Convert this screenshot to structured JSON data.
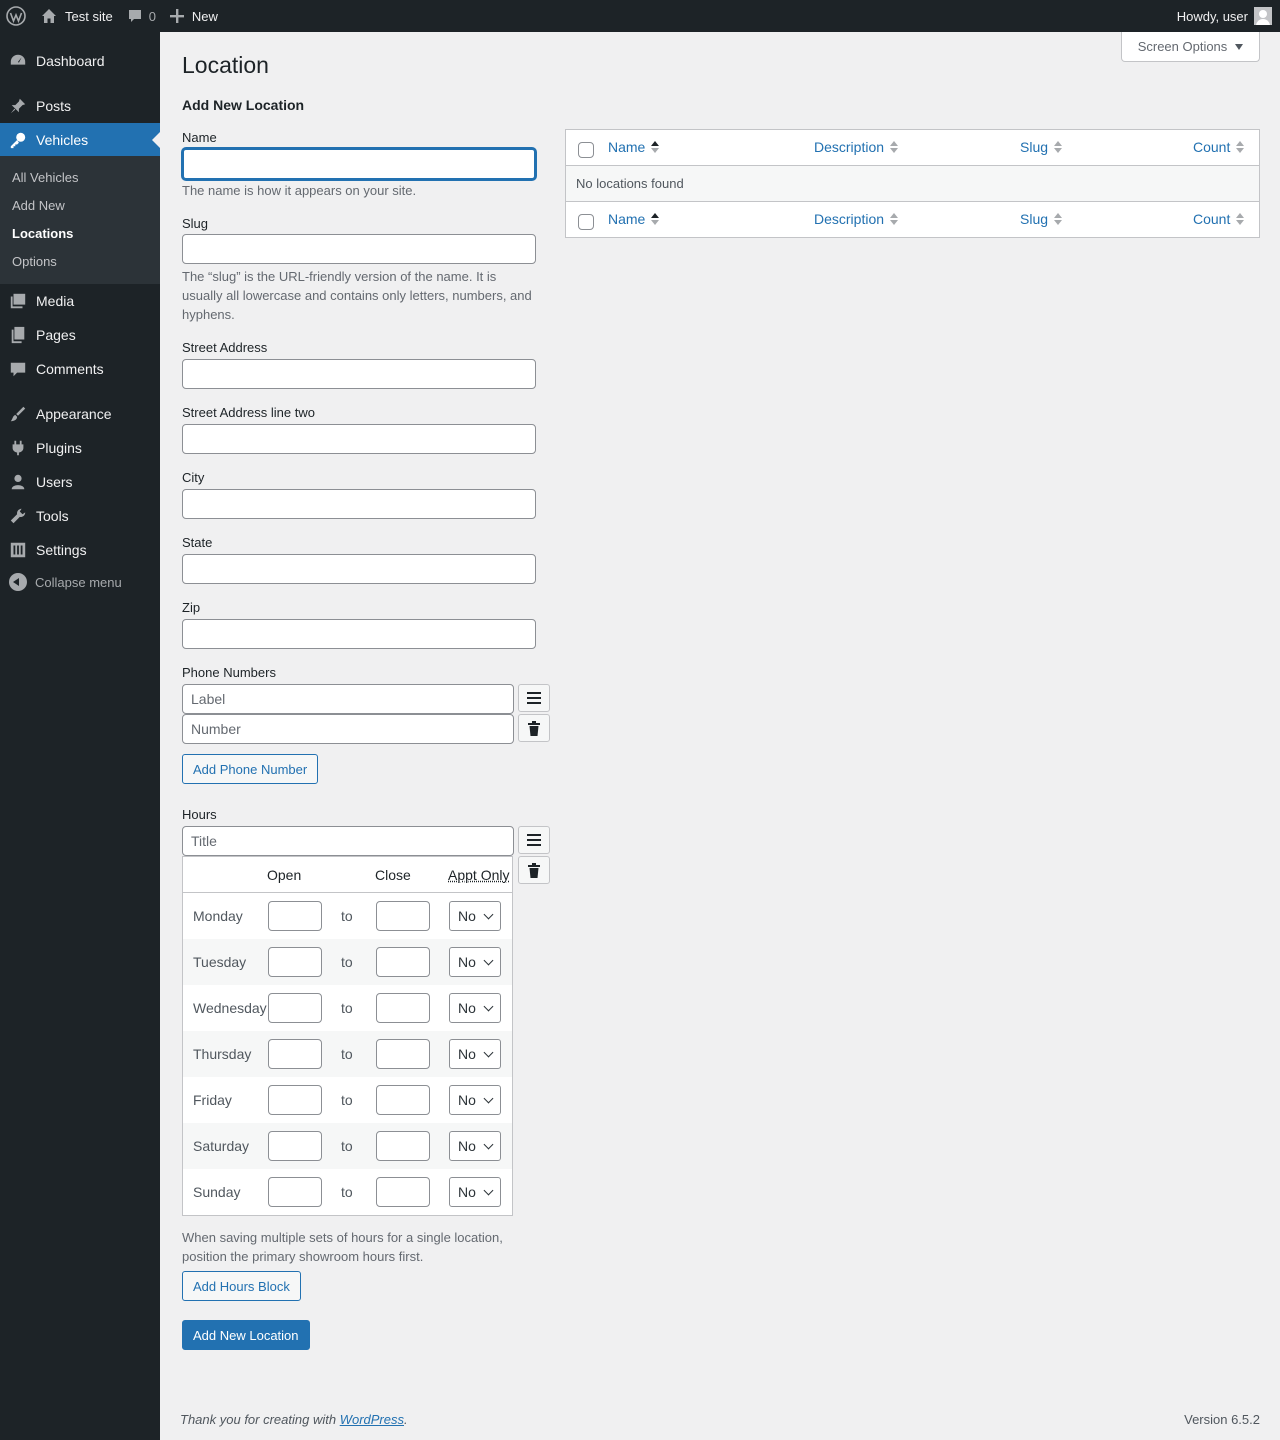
{
  "adminbar": {
    "site_name": "Test site",
    "comment_count": "0",
    "new_label": "New",
    "greeting": "Howdy, user"
  },
  "sidebar": {
    "items": [
      {
        "label": "Dashboard",
        "icon": "dashboard-icon"
      },
      {
        "label": "Posts",
        "icon": "pushpin-icon"
      },
      {
        "label": "Vehicles",
        "icon": "key-icon",
        "active": true
      },
      {
        "label": "Media",
        "icon": "media-icon"
      },
      {
        "label": "Pages",
        "icon": "pages-icon"
      },
      {
        "label": "Comments",
        "icon": "comment-icon"
      },
      {
        "label": "Appearance",
        "icon": "brush-icon"
      },
      {
        "label": "Plugins",
        "icon": "plugin-icon"
      },
      {
        "label": "Users",
        "icon": "user-icon"
      },
      {
        "label": "Tools",
        "icon": "wrench-icon"
      },
      {
        "label": "Settings",
        "icon": "sliders-icon"
      }
    ],
    "submenu": [
      "All Vehicles",
      "Add New",
      "Locations",
      "Options"
    ],
    "collapse_label": "Collapse menu"
  },
  "screen_options_label": "Screen Options",
  "page_title": "Location",
  "form": {
    "heading": "Add New Location",
    "name_label": "Name",
    "name_desc": "The name is how it appears on your site.",
    "slug_label": "Slug",
    "slug_desc": "The “slug” is the URL-friendly version of the name. It is usually all lowercase and contains only letters, numbers, and hyphens.",
    "street_label": "Street Address",
    "street2_label": "Street Address line two",
    "city_label": "City",
    "state_label": "State",
    "zip_label": "Zip",
    "phone_label": "Phone Numbers",
    "phone_label_placeholder": "Label",
    "phone_number_placeholder": "Number",
    "add_phone_button": "Add Phone Number",
    "hours_label": "Hours",
    "hours_title_placeholder": "Title",
    "hours_note": "When saving multiple sets of hours for a single location, position the primary showroom hours first.",
    "add_hours_button": "Add Hours Block",
    "submit_button": "Add New Location"
  },
  "hours_table": {
    "col_open": "Open",
    "col_close": "Close",
    "col_appt": "Appt Only",
    "to_label": "to",
    "select_value": "No",
    "days": [
      "Monday",
      "Tuesday",
      "Wednesday",
      "Thursday",
      "Friday",
      "Saturday",
      "Sunday"
    ]
  },
  "list_table": {
    "columns": [
      "Name",
      "Description",
      "Slug",
      "Count"
    ],
    "empty_message": "No locations found"
  },
  "footer": {
    "thanks_prefix": "Thank you for creating with ",
    "wordpress_link": "WordPress",
    "thanks_suffix": ".",
    "version": "Version 6.5.2"
  },
  "colors": {
    "accent": "#2271b1",
    "sidebar_bg": "#1d2327",
    "submenu_bg": "#2c3338",
    "page_bg": "#f0f0f1"
  }
}
